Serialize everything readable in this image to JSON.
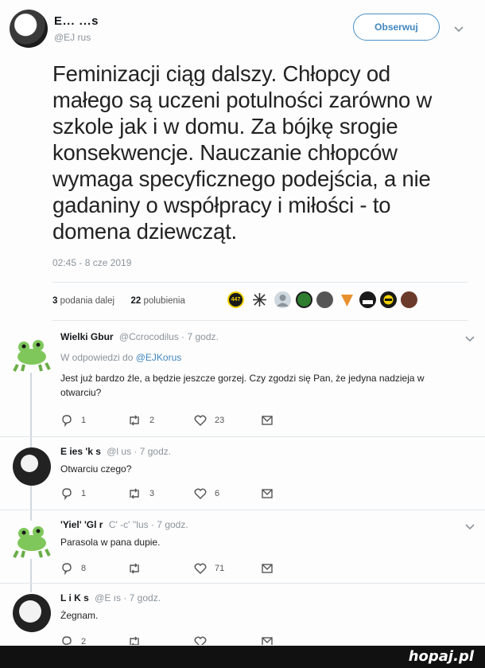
{
  "main_tweet": {
    "author_name": "E...  ...s",
    "author_handle": "@EJ  rus",
    "follow_label": "Obserwuj",
    "text": "Feminizacji ciąg dalszy. Chłopcy od małego są uczeni potulności zarówno w szkole jak i w domu. Za bójkę srogie konsekwencje. Nauczanie chłopców wymaga specyficznego podejścia, a nie gadaniny o współpracy i miłości - to domena dziewcząt.",
    "timestamp": "02:45 - 8 cze 2019",
    "retweets_count": "3",
    "retweets_label": "podania dalej",
    "likes_count": "22",
    "likes_label": "polubienia",
    "liker_avatar_badge": "447"
  },
  "replies": [
    {
      "name": "Wielki Gbur",
      "meta": "@Ccrocodilus · 7 godz.",
      "reply_to_prefix": "W odpowiedzi do",
      "reply_to_handle": "@EJKorus",
      "text": "Jest już bardzo źle, a będzie jeszcze gorzej. Czy zgodzi się Pan, że jedyna nadzieja w otwarciu?",
      "replies": "1",
      "retweets": "2",
      "likes": "23"
    },
    {
      "name": "E  ies  'k   s",
      "meta": "@l      us · 7 godz.",
      "text": "Otwarciu czego?",
      "replies": "1",
      "retweets": "3",
      "likes": "6"
    },
    {
      "name": "'Yiel'  'Gl   r",
      "meta": "C'      -c'   ''lus · 7 godz.",
      "text": "Parasola w pana dupie.",
      "replies": "8",
      "retweets": "",
      "likes": "71"
    },
    {
      "name": "L   i    K    s",
      "meta": "@E        ıs · 7 godz.",
      "text": "Żegnam.",
      "replies": "2",
      "retweets": "",
      "likes": ""
    }
  ],
  "watermark": "hopaj.pl",
  "colors": {
    "link": "#3f87c0",
    "muted": "#8a949c",
    "text": "#14171a",
    "divider": "#e1e6ea",
    "frog_green": "#7fc75b"
  },
  "icons": [
    "chevron-down-icon",
    "reply-icon",
    "retweet-icon",
    "like-icon",
    "message-icon",
    "frog-avatar",
    "bw-avatar"
  ]
}
